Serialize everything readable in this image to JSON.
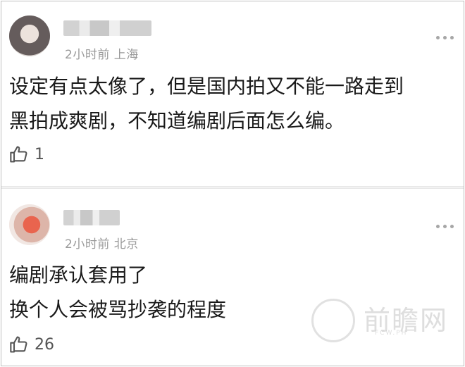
{
  "comments": [
    {
      "meta": "2小时前 上海",
      "lines": [
        "设定有点太像了，但是国内拍又不能一路走到",
        "黑拍成爽剧，不知道编剧后面怎么编。"
      ],
      "likes": "1"
    },
    {
      "meta": "2小时前 北京",
      "lines": [
        "编剧承认套用了",
        "换个人会被骂抄袭的程度"
      ],
      "likes": "26"
    }
  ],
  "watermark": {
    "text": "前瞻网",
    "url": "FCW.PH"
  },
  "colors": {
    "meta_text": "#9a9a9a",
    "body_text": "#1a1a1a",
    "like_text": "#555555"
  },
  "icons": {
    "like": "thumbs-up-icon",
    "more": "more-dots-icon"
  }
}
